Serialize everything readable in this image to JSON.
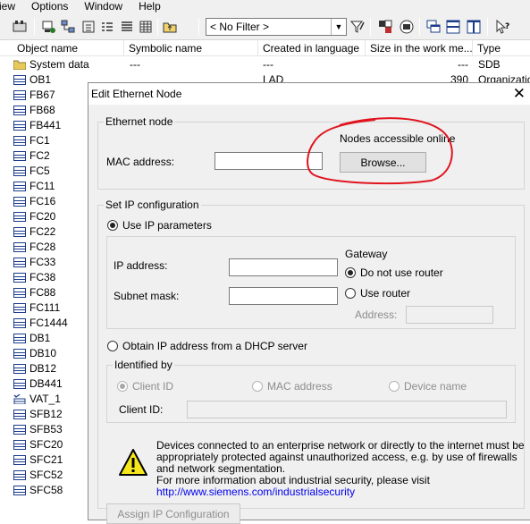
{
  "menu": [
    "iew",
    "Options",
    "Window",
    "Help"
  ],
  "toolbar": {
    "filter_value": "< No Filter >"
  },
  "columns": [
    "Object name",
    "Symbolic name",
    "Created in language",
    "Size in the work me...",
    "Type"
  ],
  "rows": [
    {
      "name": "System data",
      "symbolic": "---",
      "lang": "---",
      "size": "---",
      "type": "SDB",
      "icon": "folder-icon"
    },
    {
      "name": "OB1",
      "symbolic": "",
      "lang": "LAD",
      "size": "390",
      "type": "Organization",
      "icon": "block-icon"
    },
    {
      "name": "FB67",
      "icon": "block-icon"
    },
    {
      "name": "FB68",
      "icon": "block-icon"
    },
    {
      "name": "FB441",
      "icon": "block-icon"
    },
    {
      "name": "FC1",
      "icon": "block-icon"
    },
    {
      "name": "FC2",
      "icon": "block-icon"
    },
    {
      "name": "FC5",
      "icon": "block-icon"
    },
    {
      "name": "FC11",
      "icon": "block-icon"
    },
    {
      "name": "FC16",
      "icon": "block-icon"
    },
    {
      "name": "FC20",
      "icon": "block-icon"
    },
    {
      "name": "FC22",
      "icon": "block-icon"
    },
    {
      "name": "FC28",
      "icon": "block-icon"
    },
    {
      "name": "FC33",
      "icon": "block-icon"
    },
    {
      "name": "FC38",
      "icon": "block-icon"
    },
    {
      "name": "FC88",
      "icon": "block-icon"
    },
    {
      "name": "FC111",
      "icon": "block-icon"
    },
    {
      "name": "FC1444",
      "icon": "block-icon"
    },
    {
      "name": "DB1",
      "icon": "block-icon"
    },
    {
      "name": "DB10",
      "icon": "block-icon"
    },
    {
      "name": "DB12",
      "icon": "block-icon"
    },
    {
      "name": "DB441",
      "icon": "block-icon"
    },
    {
      "name": "VAT_1",
      "icon": "vat-icon"
    },
    {
      "name": "SFB12",
      "icon": "block-icon"
    },
    {
      "name": "SFB53",
      "icon": "block-icon"
    },
    {
      "name": "SFC20",
      "icon": "block-icon"
    },
    {
      "name": "SFC21",
      "icon": "block-icon"
    },
    {
      "name": "SFC52",
      "icon": "block-icon"
    },
    {
      "name": "SFC58",
      "icon": "block-icon"
    }
  ],
  "dialog": {
    "title": "Edit Ethernet Node",
    "ethernet_group": "Ethernet node",
    "nodes_online_label": "Nodes accessible online",
    "mac_label": "MAC address:",
    "mac_value": "",
    "browse_button": "Browse...",
    "ip_group": "Set IP configuration",
    "use_ip_params": "Use IP parameters",
    "ip_label": "IP address:",
    "subnet_label": "Subnet mask:",
    "gateway_label": "Gateway",
    "no_router": "Do not use router",
    "use_router": "Use router",
    "address_label": "Address:",
    "dhcp_label": "Obtain IP address from a DHCP server",
    "identified_group": "Identified by",
    "client_id": "Client ID",
    "mac_address_opt": "MAC address",
    "device_name": "Device name",
    "client_id_label": "Client ID:",
    "security_lines": [
      "Devices connected to an enterprise network or directly to the internet must be",
      "appropriately protected against unauthorized access, e.g. by use of firewalls",
      "and network segmentation.",
      "For more information about industrial security, please visit"
    ],
    "security_link": "http://www.siemens.com/industrialsecurity",
    "assign_button": "Assign IP Configuration"
  },
  "colors": {
    "annotation": "#e0141e",
    "link": "#0000ee",
    "dialog_bg": "#f0f0f0"
  }
}
